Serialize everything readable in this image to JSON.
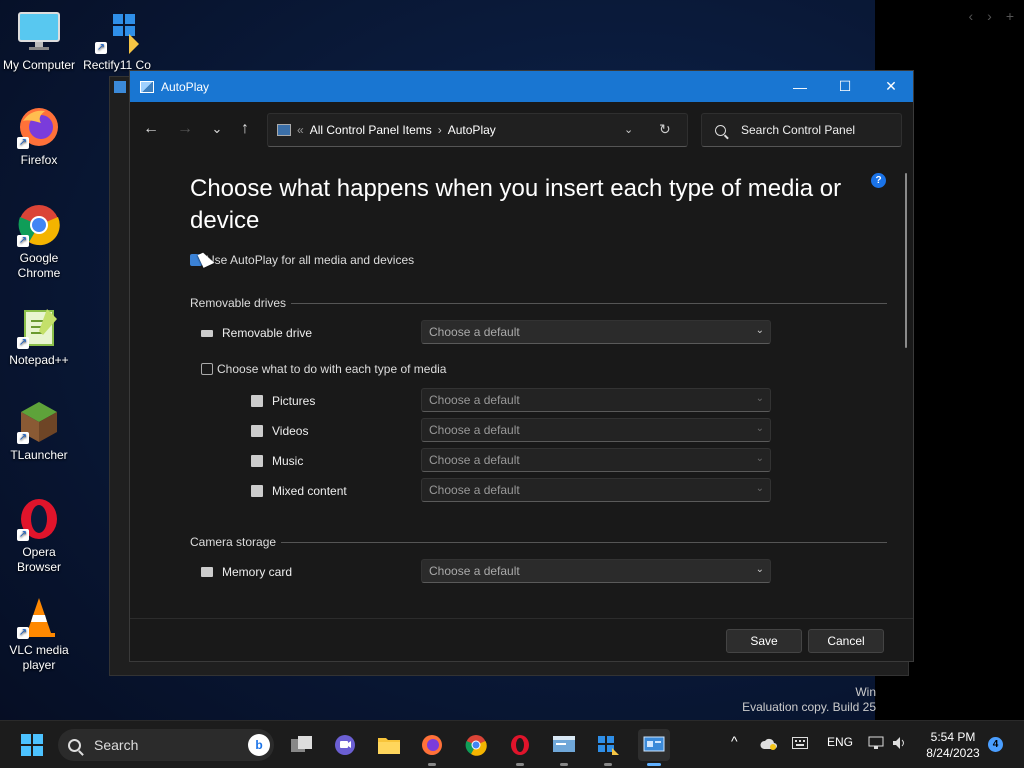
{
  "desktop": {
    "icons": [
      {
        "label": "My Computer"
      },
      {
        "label": "Rectify11 Co"
      },
      {
        "label": "Firefox"
      },
      {
        "label": "Google Chrome"
      },
      {
        "label": "Notepad++"
      },
      {
        "label": "TLauncher"
      },
      {
        "label": "Opera Browser"
      },
      {
        "label": "VLC media player"
      }
    ],
    "watermark": {
      "line1": "Win",
      "line2": "Evaluation copy. Build 25"
    }
  },
  "window": {
    "title": "AutoPlay",
    "controls": {
      "minimize": "—",
      "maximize": "☐",
      "close": "✕"
    },
    "nav": {
      "back": "←",
      "forward": "→",
      "recent": "⌄",
      "up": "↑"
    },
    "address": {
      "prefix": "«",
      "crumbs": [
        "All Control Panel Items",
        "AutoPlay"
      ],
      "separator": "›",
      "dropdown": "⌄",
      "refresh": "↻"
    },
    "search": {
      "placeholder": "Search Control Panel"
    },
    "help": "?",
    "heading": "Choose what happens when you insert each type of media or device",
    "use_autoplay": {
      "label": "Use AutoPlay for all media and devices",
      "checked": true
    },
    "removable": {
      "section": "Removable drives",
      "drive": {
        "label": "Removable drive",
        "value": "Choose a default"
      },
      "per_media": {
        "label": "Choose what to do with each type of media",
        "checked": false
      },
      "media": [
        {
          "label": "Pictures",
          "value": "Choose a default"
        },
        {
          "label": "Videos",
          "value": "Choose a default"
        },
        {
          "label": "Music",
          "value": "Choose a default"
        },
        {
          "label": "Mixed content",
          "value": "Choose a default"
        }
      ]
    },
    "camera": {
      "section": "Camera storage",
      "memory_card": {
        "label": "Memory card",
        "value": "Choose a default"
      }
    },
    "footer": {
      "save": "Save",
      "cancel": "Cancel"
    }
  },
  "taskbar": {
    "search_label": "Search",
    "bing": "b",
    "tray": {
      "language": "ENG",
      "time": "5:54 PM",
      "date": "8/24/2023",
      "notifications": "4",
      "overflow": "^"
    }
  },
  "strip_nav": {
    "back": "‹",
    "forward": "›",
    "add": "+"
  },
  "colors": {
    "titlebar": "#1976d2",
    "accent": "#3b82d6",
    "window_bg": "#191919"
  }
}
